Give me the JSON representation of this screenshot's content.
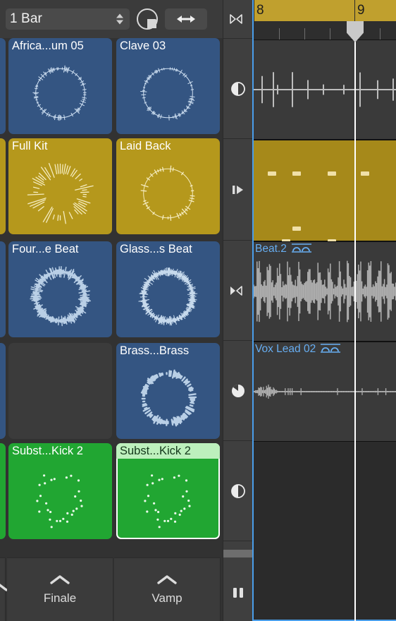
{
  "app": "Logic Pro Live Loops",
  "toolbar": {
    "quantize_value": "1 Bar",
    "quantize_icon": "chevron-updown-icon",
    "pie_icon": "playback-pie-icon",
    "resize_icon": "horizontal-resize-icon"
  },
  "grid": {
    "rows": [
      {
        "cells": [
          {
            "title": "",
            "state": "empty-partial",
            "color": "#345582",
            "art": "none",
            "selected": false
          },
          {
            "title": "Africa...um 05",
            "state": "loaded",
            "color": "#345582",
            "art": "ring-spiky-sparse",
            "selected": false
          },
          {
            "title": "Clave 03",
            "state": "loaded",
            "color": "#345582",
            "art": "ring-spiky-thin",
            "selected": false
          }
        ]
      },
      {
        "cells": [
          {
            "title": "",
            "state": "empty-partial",
            "color": "#b5981c",
            "art": "none",
            "selected": false
          },
          {
            "title": "Full Kit",
            "state": "loaded",
            "color": "#b5981c",
            "art": "radial-burst",
            "selected": false
          },
          {
            "title": "Laid Back",
            "state": "loaded",
            "color": "#b5981c",
            "art": "radial-sparse",
            "selected": false
          }
        ]
      },
      {
        "cells": [
          {
            "title": "",
            "state": "empty-partial",
            "color": "#345582",
            "art": "none",
            "selected": false
          },
          {
            "title": "Four...e Beat",
            "state": "loaded",
            "color": "#345582",
            "art": "ring-thick-jagged",
            "selected": false
          },
          {
            "title": "Glass...s Beat",
            "state": "loaded",
            "color": "#345582",
            "art": "ring-dense-fine",
            "selected": false
          }
        ]
      },
      {
        "cells": [
          {
            "title": "",
            "state": "empty-partial",
            "color": "#345582",
            "art": "none",
            "selected": false
          },
          {
            "title": "",
            "state": "empty",
            "color": "#3b3b3b",
            "art": "none",
            "selected": false
          },
          {
            "title": "Brass...Brass",
            "state": "loaded",
            "color": "#345582",
            "art": "ring-chunky",
            "selected": false
          }
        ]
      },
      {
        "cells": [
          {
            "title": "",
            "state": "empty-partial",
            "color": "#21a632",
            "art": "none",
            "selected": false
          },
          {
            "title": "Subst...Kick 2",
            "state": "loaded",
            "color": "#21a632",
            "art": "dots-pattern",
            "selected": false
          },
          {
            "title": "Subst...Kick 2",
            "state": "loaded",
            "color": "#21a632",
            "art": "dots-pattern",
            "selected": true
          }
        ]
      }
    ]
  },
  "scene_triggers": [
    {
      "label": "",
      "icon": "chevron-up-icon"
    },
    {
      "label": "Finale",
      "icon": "chevron-up-icon"
    },
    {
      "label": "Vamp",
      "icon": "chevron-up-icon"
    }
  ],
  "state_column": {
    "items": [
      {
        "icon": "play-prev-next-icon",
        "name": "stop-all-triangles"
      },
      {
        "icon": "half-circle-icon",
        "name": "track-state-half-circle"
      },
      {
        "icon": "bar-play-icon",
        "name": "track-state-bar-play"
      },
      {
        "icon": "play-prev-next-filled-icon",
        "name": "track-state-triangles"
      },
      {
        "icon": "pie-wedge-icon",
        "name": "track-state-pie"
      },
      {
        "icon": "half-circle-icon",
        "name": "track-state-half-circle-2"
      },
      {
        "icon": "pause-icon",
        "name": "stop-button"
      }
    ]
  },
  "arrange": {
    "ruler": {
      "bars": [
        "8",
        "9"
      ],
      "bar_color": "#c0a02e"
    },
    "playhead_position_bar": "9",
    "tracks": [
      {
        "name": "",
        "type": "audio",
        "region_name": "",
        "looped": false,
        "waveform": "sparse-transients"
      },
      {
        "name": "",
        "type": "midi",
        "region_name": "",
        "looped": false,
        "notes": 6
      },
      {
        "name": "Beat.2",
        "type": "audio",
        "region_name": "Beat.2",
        "looped": true,
        "waveform": "dense-drums"
      },
      {
        "name": "Vox Lead 02",
        "type": "audio",
        "region_name": "Vox Lead 02",
        "looped": true,
        "waveform": "vocal-blobs"
      },
      {
        "name": "",
        "type": "empty",
        "region_name": "",
        "looped": false,
        "waveform": "none"
      },
      {
        "name": "",
        "type": "empty",
        "region_name": "",
        "looped": false,
        "waveform": "none"
      }
    ]
  },
  "colors": {
    "accent_blue": "#4a9eea",
    "audio_blue": "#345582",
    "midi_gold": "#b5981c",
    "drummer_green": "#21a632",
    "ruler_gold": "#c0a02e"
  }
}
